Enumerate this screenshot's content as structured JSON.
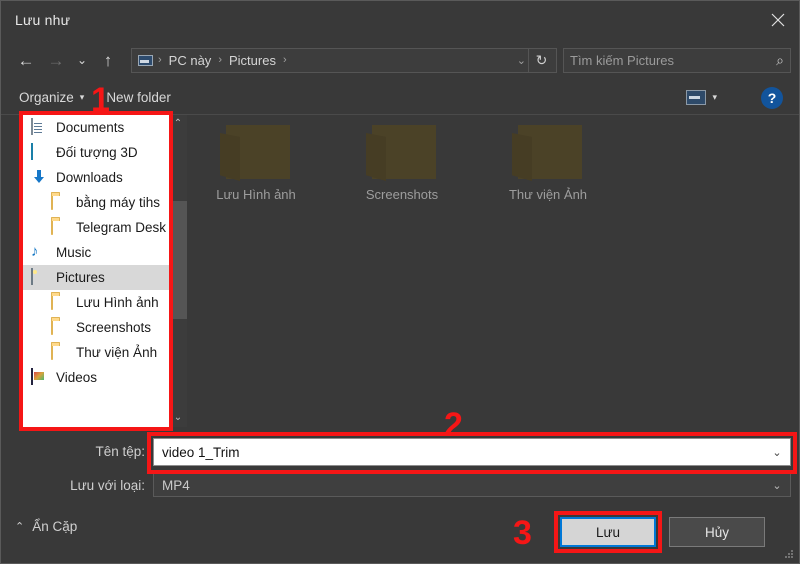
{
  "window": {
    "title": "Lưu như",
    "close_icon": "close-icon"
  },
  "nav": {
    "back_icon": "arrow-left-icon",
    "forward_icon": "arrow-right-icon",
    "recent_icon": "chevron-down-icon",
    "up_icon": "arrow-up-icon",
    "refresh_icon": "refresh-icon",
    "breadcrumb": {
      "computer_icon": "this-pc-icon",
      "items": [
        "PC này",
        "Pictures"
      ],
      "separator": "›"
    }
  },
  "search": {
    "placeholder": "Tìm kiếm Pictures",
    "icon": "search-icon"
  },
  "commandbar": {
    "organize_label": "Organize",
    "organize_caret": "▾",
    "new_folder_label": "New folder",
    "view_icon": "view-layout-icon",
    "view_caret": "▾",
    "help_label": "?"
  },
  "sidebar": {
    "items": [
      {
        "label": "Documents",
        "icon": "documents-icon",
        "indent": false,
        "selected": false
      },
      {
        "label": "Đối tượng 3D",
        "icon": "3d-objects-icon",
        "indent": false,
        "selected": false
      },
      {
        "label": "Downloads",
        "icon": "downloads-icon",
        "indent": false,
        "selected": false
      },
      {
        "label": "bằng máy tihs",
        "icon": "folder-icon",
        "indent": true,
        "selected": false
      },
      {
        "label": "Telegram Desk",
        "icon": "folder-icon",
        "indent": true,
        "selected": false
      },
      {
        "label": "Music",
        "icon": "music-icon",
        "indent": false,
        "selected": false
      },
      {
        "label": "Pictures",
        "icon": "pictures-icon",
        "indent": false,
        "selected": true
      },
      {
        "label": "Lưu Hình ảnh",
        "icon": "folder-icon",
        "indent": true,
        "selected": false
      },
      {
        "label": "Screenshots",
        "icon": "folder-icon",
        "indent": true,
        "selected": false
      },
      {
        "label": "Thư viện Ảnh",
        "icon": "folder-icon",
        "indent": true,
        "selected": false
      },
      {
        "label": "Videos",
        "icon": "videos-icon",
        "indent": false,
        "selected": false
      }
    ],
    "scroll_up_icon": "chevron-up-icon",
    "scroll_down_icon": "chevron-down-icon"
  },
  "filepane": {
    "items": [
      {
        "label": "Lưu Hình ảnh",
        "icon": "folder-icon"
      },
      {
        "label": "Screenshots",
        "icon": "folder-icon"
      },
      {
        "label": "Thư viện Ảnh",
        "icon": "folder-icon"
      }
    ]
  },
  "form": {
    "filename_label": "Tên tệp:",
    "filename_value": "video 1_Trim",
    "filename_chevron": "⌄",
    "filetype_label": "Lưu với loại:",
    "filetype_value": "MP4",
    "filetype_chevron": "⌄",
    "hide_folders_label": "Ẩn Cặp",
    "hide_folders_chevron": "⌃"
  },
  "buttons": {
    "save_label": "Lưu",
    "cancel_label": "Hủy"
  },
  "annotations": {
    "color": "#f51616",
    "markers": [
      {
        "number": "1",
        "target": "sidebar"
      },
      {
        "number": "2",
        "target": "filename-input"
      },
      {
        "number": "3",
        "target": "save-button"
      }
    ]
  }
}
